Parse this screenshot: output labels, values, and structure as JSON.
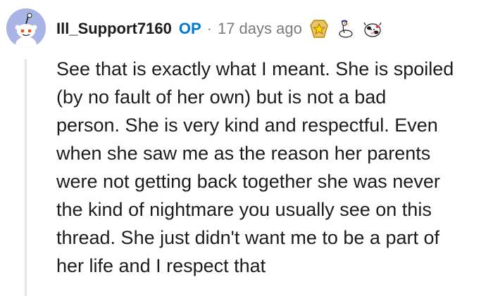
{
  "comment": {
    "author": "Ill_Support7160",
    "op_badge": "OP",
    "separator": "·",
    "timestamp": "17 days ago",
    "avatar_icon": "snoo-avatar-icon",
    "awards": [
      "gold-star-award-icon",
      "goose-award-icon",
      "cow-award-icon"
    ],
    "body_lines": [
      "See that is exactly what I meant. She is spoiled",
      "(by no fault of her own) but is not a bad",
      "person. She is very kind and respectful. Even",
      "when she saw me as the reason her parents",
      "were not getting back together she was never",
      "the kind of nightmare you usually see on this",
      "thread. She just didn't want me to be a part of",
      "her life and I respect that"
    ]
  },
  "colors": {
    "op": "#0079d3",
    "meta": "#787c7e",
    "text": "#1c1c1c",
    "thread_line": "#e4e6e8",
    "avatar_bg": "#a8b3e6"
  }
}
